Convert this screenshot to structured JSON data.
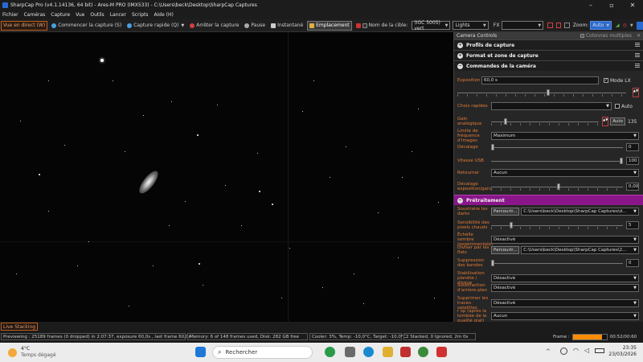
{
  "window": {
    "title": "SharpCap Pro (v4.1.14136, 64 bit) - Ares-M PRO (IMX533) - C:\\Users\\beck\\Desktop\\SharpCap Captures"
  },
  "menu": [
    "Fichier",
    "Caméras",
    "Capture",
    "Vue",
    "Outils",
    "Lancer",
    "Scripts",
    "Aide (H)"
  ],
  "toolbar": {
    "live": "Vue en direct (W)",
    "start": "Commencer la capture (S)",
    "quick": "Capture rapide (Q)",
    "stop": "Arrêter la capture",
    "pause": "Pause",
    "snapshot": "Instantané",
    "placement": "Emplacement",
    "target_label": "Nom de la cible:",
    "target": "(IGC 5005) vert",
    "frame_type": "Lights",
    "fx_label": "FX",
    "zoom_label": "Zoom:",
    "zoom": "Auto"
  },
  "panel": {
    "header": "Camera Controls",
    "multi": "Colonnes multiples",
    "sections": {
      "profiles": "Profils de capture",
      "format": "Format et zone de capture",
      "camera": "Commandes de la caméra",
      "preproc": "Prétraitement"
    },
    "exposure": {
      "label": "Exposition",
      "value": "60,0 s",
      "mode": "Mode LX",
      "ticks": [
        "",
        "1",
        "",
        "",
        "",
        "",
        "",
        "",
        "",
        "",
        "",
        ""
      ],
      "quick": "Choix rapides",
      "auto": "Auto"
    },
    "gain": {
      "label": "Gain analogique",
      "auto": "Auto",
      "value": "135",
      "pos": 0.12
    },
    "frequency": {
      "label": "Limite de fréquence d'images",
      "value": "Maximum"
    },
    "offset": {
      "label": "Décalage",
      "value": "0"
    },
    "usb": {
      "label": "Vitesse USB",
      "value": "100"
    },
    "flip": {
      "label": "Retourner",
      "value": "Aucun"
    },
    "expgain": {
      "label": "Décalage exposition/gain",
      "value": "0,00"
    },
    "darks": {
      "label": "Soustraire les darks",
      "browse": "Parcourir...",
      "path": "C:\\Users\\beck\\Desktop\\SharpCap Captures\\d..."
    },
    "hotpix": {
      "label": "Sensibilité des pixels chauds",
      "value": "5"
    },
    "darkscale": {
      "label": "Échelle sombre (expérimentale)",
      "value": "Désactivé"
    },
    "flats": {
      "label": "Diviser par les flats",
      "browse": "Parcourir...",
      "path": "C:\\Users\\beck\\Desktop\\SharpCap Captures\\2..."
    },
    "banding": {
      "label": "Suppression des bandes",
      "value": "0"
    },
    "stab": {
      "label": "Stabilisation planète / disque",
      "value": "Désactivé"
    },
    "bgsub": {
      "label": "Soustraction d'arrière-plan",
      "value": "Désactivé"
    },
    "sat": {
      "label": "Supprimer les traces satellites",
      "value": "Désactivé"
    },
    "drop": {
      "label": "r sp (après la tombée de la qualité plat)",
      "value": "Aucun"
    }
  },
  "status": {
    "live_stacking": "Live Stacking",
    "preview": "Previewing : 25189 frames (0 dropped) in 2:07:37, exposure 60,0s , last frame 60,0s",
    "memory": "Memory: 6 of 148 frames used, Disk: 282 GB free",
    "cooler": "Cooler: 3%, Temp: -10,0°C, Target: -10,0°C",
    "stacked": "2 Stacked, 0 Ignored, 2m 0s",
    "frame_label": "Frame :",
    "frame_time": "00:52/00:60",
    "progress": 0.86
  },
  "taskbar": {
    "temp": "4°C",
    "weather": "Temps dégagé",
    "search": "Rechercher",
    "time": "23:35",
    "date": "23/03/2026"
  },
  "colors": {
    "accent": "#e27b36",
    "purple": "#8a168a",
    "progress": "#ff8c00"
  }
}
